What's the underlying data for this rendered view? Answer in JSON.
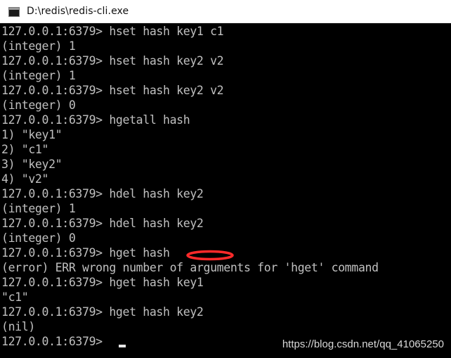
{
  "window": {
    "title": "D:\\redis\\redis-cli.exe",
    "icon": "console-window-icon"
  },
  "console": {
    "lines": [
      "127.0.0.1:6379> hset hash key1 c1",
      "(integer) 1",
      "127.0.0.1:6379> hset hash key2 v2",
      "(integer) 1",
      "127.0.0.1:6379> hset hash key2 v2",
      "(integer) 0",
      "127.0.0.1:6379> hgetall hash",
      "1) \"key1\"",
      "2) \"c1\"",
      "3) \"key2\"",
      "4) \"v2\"",
      "127.0.0.1:6379> hdel hash key2",
      "(integer) 1",
      "127.0.0.1:6379> hdel hash key2",
      "(integer) 0",
      "127.0.0.1:6379> hget hash",
      "(error) ERR wrong number of arguments for 'hget' command",
      "127.0.0.1:6379> hget hash key1",
      "\"c1\"",
      "127.0.0.1:6379> hget hash key2",
      "(nil)",
      "127.0.0.1:6379> "
    ],
    "annotation": {
      "shape": "ellipse",
      "color": "#ff2a2a"
    }
  },
  "watermark": "https://blog.csdn.net/qq_41065250",
  "colors": {
    "console_bg": "#000000",
    "console_text": "#c0c0c0",
    "title_bg": "#ffffff"
  }
}
